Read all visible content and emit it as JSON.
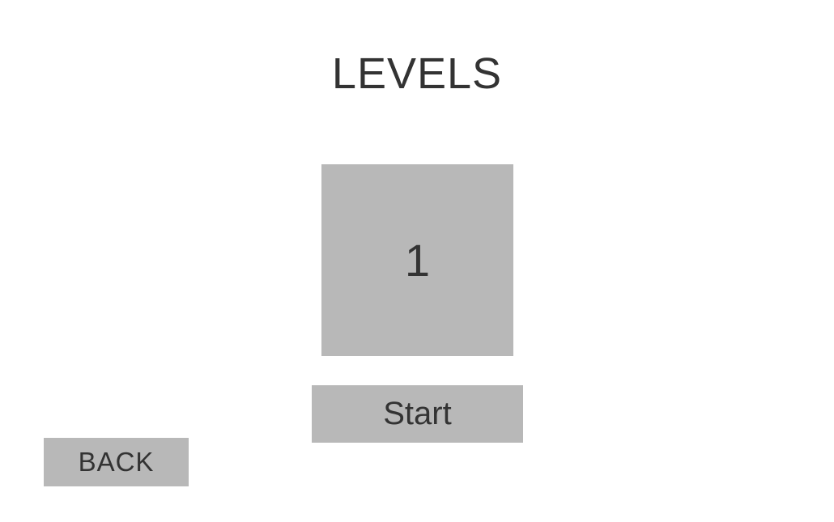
{
  "header": {
    "title": "LEVELS"
  },
  "levels": [
    {
      "label": "1"
    }
  ],
  "actions": {
    "start_label": "Start",
    "back_label": "BACK"
  },
  "colors": {
    "background": "#ffffff",
    "tile": "#b8b8b8",
    "text": "#333333"
  }
}
